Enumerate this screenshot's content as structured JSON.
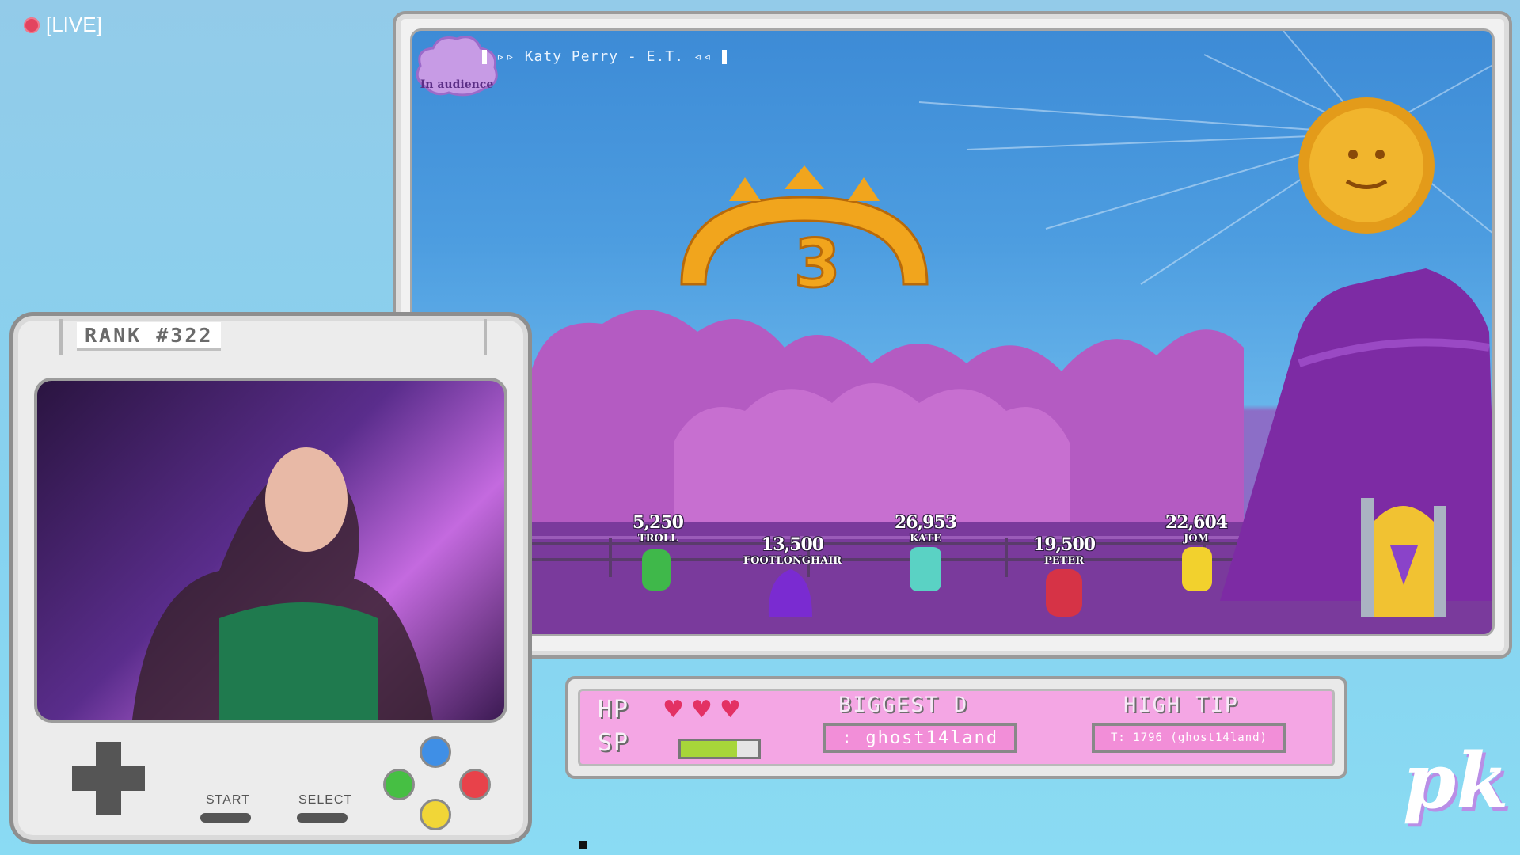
{
  "live": {
    "label": "[LIVE]"
  },
  "game": {
    "audience_label": "In audience",
    "now_playing": "Katy Perry - E.T.",
    "countdown": "3",
    "players": [
      {
        "score": "5,250",
        "name": "TROLL",
        "color": "#3fb84a"
      },
      {
        "score": "13,500",
        "name": "FOOTLONGHAIR",
        "color": "#7a2bd1"
      },
      {
        "score": "26,953",
        "name": "KATE",
        "color": "#5ad2c4"
      },
      {
        "score": "19,500",
        "name": "PETER",
        "color": "#d63346"
      },
      {
        "score": "22,604",
        "name": "JOM",
        "color": "#f2d12d"
      }
    ]
  },
  "webcam": {
    "rank": "RANK #322",
    "start_label": "START",
    "select_label": "SELECT",
    "button_colors": {
      "top": "#3f8fe6",
      "left": "#46bf43",
      "right": "#e8424a",
      "bottom": "#f1d637"
    }
  },
  "hud": {
    "hp_label": "HP",
    "sp_label": "SP",
    "hearts": 3,
    "sp_level": 0.72,
    "biggest_title": "BIGGEST D",
    "biggest_value": ": ghost14land",
    "tip_title": "HIGH TIP",
    "tip_value": "T: 1796 (ghost14land)"
  },
  "logo": "pk"
}
